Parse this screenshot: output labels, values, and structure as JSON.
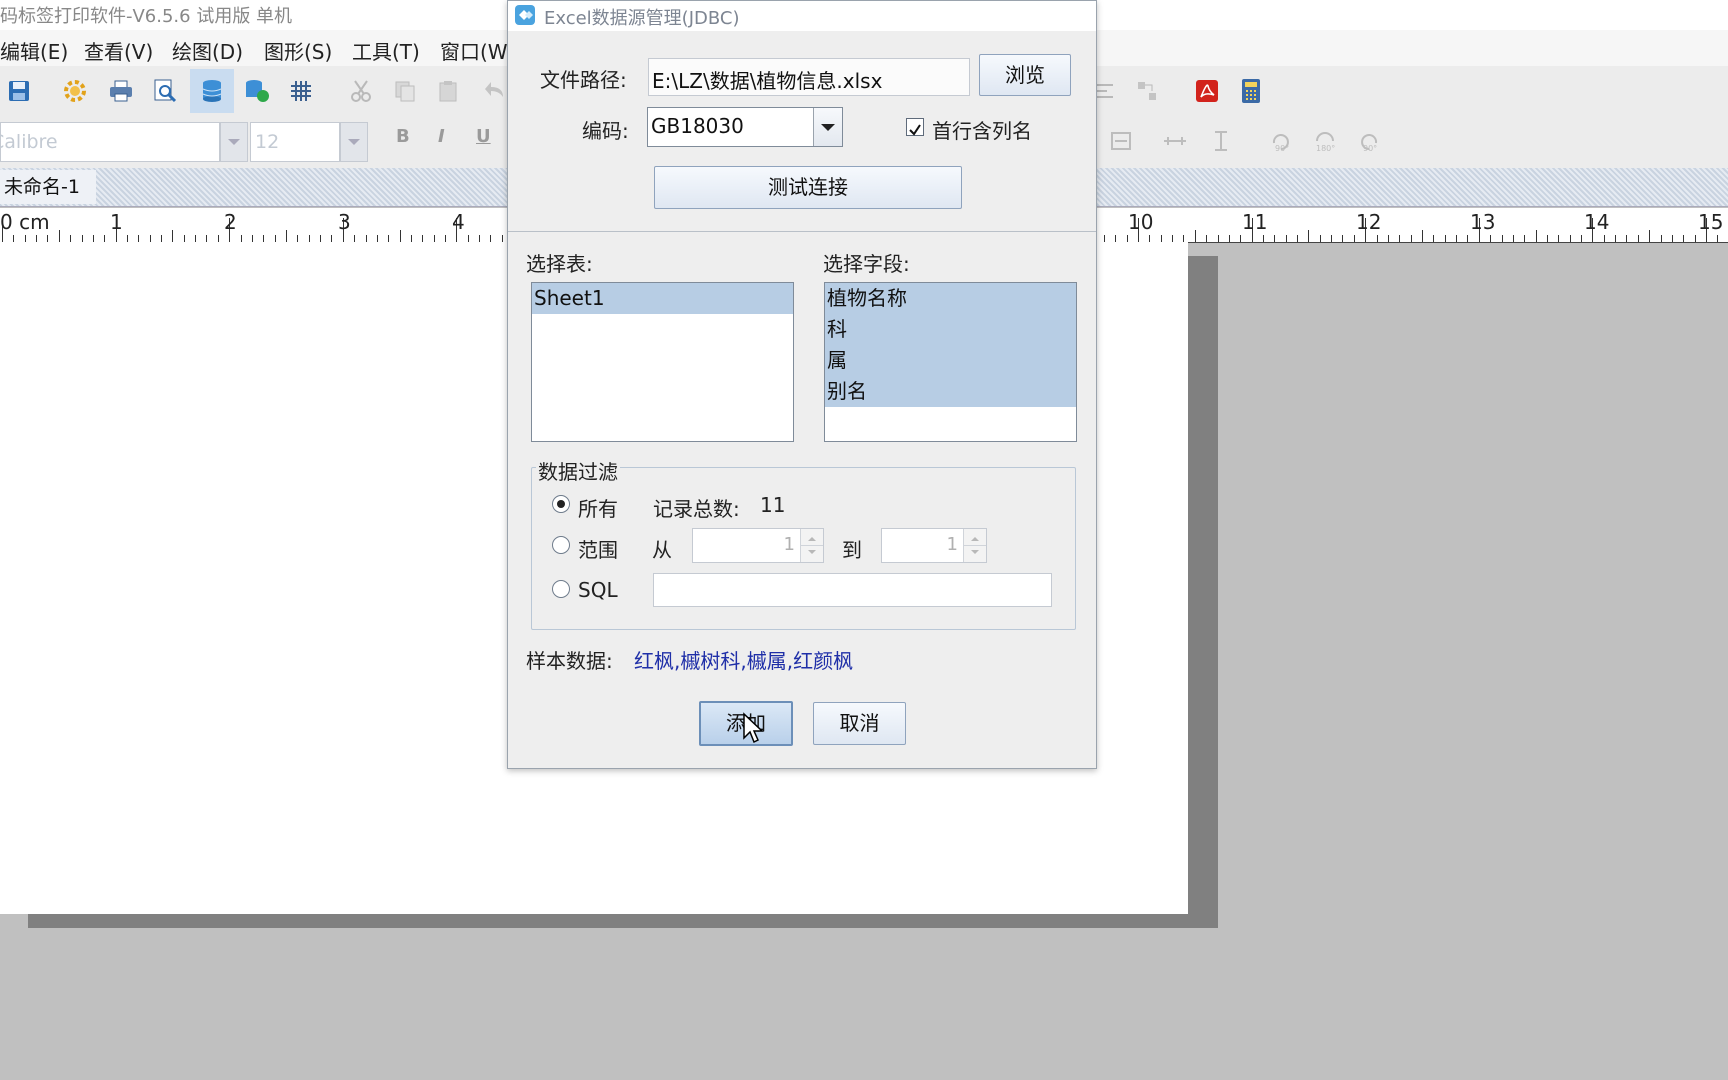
{
  "app": {
    "title": "码标签打印软件-V6.5.6 试用版 单机",
    "menus": [
      "编辑(E)",
      "查看(V)",
      "绘图(D)",
      "图形(S)",
      "工具(T)",
      "窗口(W"
    ],
    "font_name": "Calibre",
    "font_size": "12",
    "doc_tab": "未命名-1",
    "ruler_labels": [
      "0 cm",
      "1",
      "2",
      "3",
      "4",
      "10",
      "11",
      "12",
      "13",
      "14",
      "15"
    ],
    "icons": [
      "save-icon",
      "settings-icon",
      "print-icon",
      "print-preview-icon",
      "database-icon",
      "database-link-icon",
      "grid-icon",
      "cut-icon",
      "copy-icon",
      "paste-icon",
      "undo-icon",
      "distribute-icon",
      "layout-icon",
      "pdf-icon",
      "calculator-icon"
    ]
  },
  "dialog": {
    "title": "Excel数据源管理(JDBC)",
    "file_path_label": "文件路径:",
    "file_path_value": "E:\\LZ\\数据\\植物信息.xlsx",
    "browse_button": "浏览",
    "encoding_label": "编码:",
    "encoding_value": "GB18030",
    "header_checkbox_label": "首行含列名",
    "header_checkbox_checked": true,
    "test_button": "测试连接",
    "table_label": "选择表:",
    "tables": [
      "Sheet1"
    ],
    "field_label": "选择字段:",
    "fields": [
      "植物名称",
      "科",
      "属",
      "别名"
    ],
    "filter": {
      "group_label": "数据过滤",
      "all_label": "所有",
      "record_count_label": "记录总数:",
      "record_count": "11",
      "range_label": "范围",
      "from_label": "从",
      "from_value": "1",
      "to_label": "到",
      "to_value": "1",
      "sql_label": "SQL",
      "sql_value": "",
      "selected": "all"
    },
    "sample_label": "样本数据:",
    "sample_value": "红枫,槭树科,槭属,红颜枫",
    "add_button": "添加",
    "cancel_button": "取消"
  },
  "colors": {
    "selection": "#b7cde4",
    "sample_text": "#1f2fa8",
    "button_border": "#8fa3bd",
    "canvas_bg": "#c0c0c0",
    "paper_shadow": "#808080"
  }
}
